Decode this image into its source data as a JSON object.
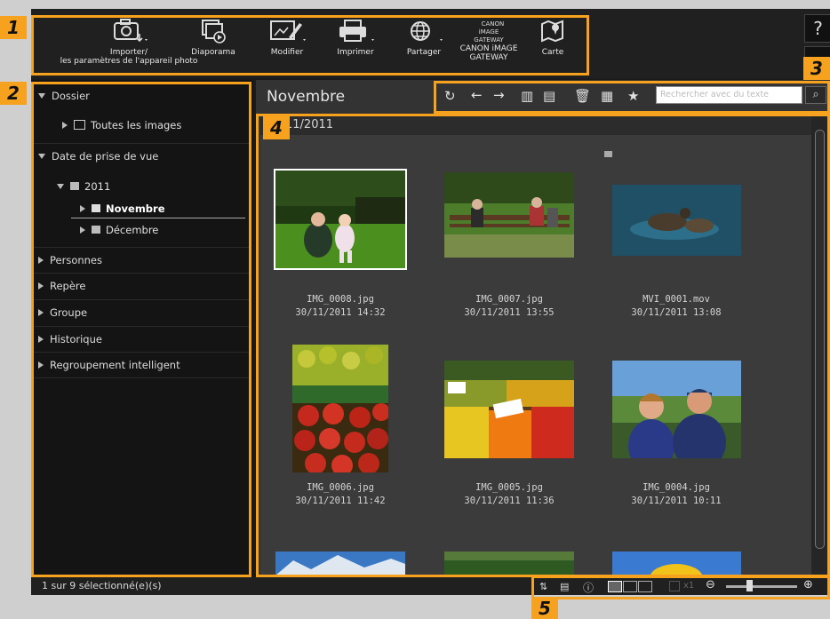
{
  "toolbar": {
    "items": [
      {
        "label": "Importer/\nles paramètres de l'appareil photo",
        "icon": "camera-import-icon"
      },
      {
        "label": "Diaporama",
        "icon": "slideshow-icon"
      },
      {
        "label": "Modifier",
        "icon": "edit-icon"
      },
      {
        "label": "Imprimer",
        "icon": "printer-icon"
      },
      {
        "label": "Partager",
        "icon": "share-globe-icon"
      },
      {
        "label": "CANON iMAGE\nGATEWAY",
        "icon": "canon-image-gateway-icon",
        "logo_text": "CANON\niMAGE\nGATEWAY"
      },
      {
        "label": "Carte",
        "icon": "map-icon"
      }
    ],
    "help": "?"
  },
  "badges": [
    "1",
    "2",
    "3",
    "4",
    "5"
  ],
  "sidebar": {
    "sections": [
      "Dossier",
      "Date de prise de vue",
      "Personnes",
      "Repère",
      "Groupe",
      "Historique",
      "Regroupement intelligent"
    ],
    "folder_all": "Toutes les images",
    "year": "2011",
    "months": [
      "Novembre",
      "Décembre"
    ]
  },
  "content": {
    "title": "Novembre",
    "search_placeholder": "Rechercher avec du texte",
    "date_group": "11/2011"
  },
  "images": [
    {
      "name": "IMG_0008.jpg",
      "date": "30/11/2011 14:32"
    },
    {
      "name": "IMG_0007.jpg",
      "date": "30/11/2011 13:55"
    },
    {
      "name": "MVI_0001.mov",
      "date": "30/11/2011 13:08"
    },
    {
      "name": "IMG_0006.jpg",
      "date": "30/11/2011 11:42"
    },
    {
      "name": "IMG_0005.jpg",
      "date": "30/11/2011 11:36"
    },
    {
      "name": "IMG_0004.jpg",
      "date": "30/11/2011 10:11"
    }
  ],
  "status": {
    "selected_text": "1 sur 9 sélectionné(e)(s)",
    "zoom_label": "x1"
  },
  "colors": {
    "accent": "#f6a21e",
    "selection": "#ffffff"
  }
}
